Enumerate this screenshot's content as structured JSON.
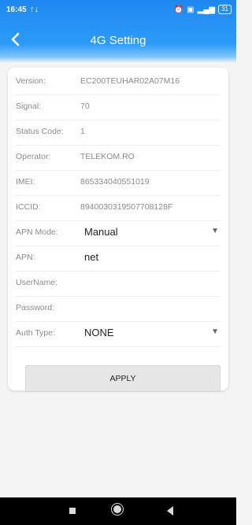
{
  "status_bar": {
    "time": "16:45",
    "network_icon": "network-arrows-icon",
    "icons": [
      "alarm-icon",
      "data-icon",
      "signal-icon"
    ],
    "battery": "31"
  },
  "header": {
    "title": "4G Setting",
    "back_icon": "chevron-left-icon",
    "accent": "#1e88f2"
  },
  "fields": {
    "version": {
      "label": "Version:",
      "value": "EC200TEUHAR02A07M16"
    },
    "signal": {
      "label": "Signal:",
      "value": "70"
    },
    "status_code": {
      "label": "Status Code:",
      "value": "1"
    },
    "operator": {
      "label": "Operator:",
      "value": "TELEKOM.RO"
    },
    "imei": {
      "label": "IMEI:",
      "value": "865334040551019"
    },
    "iccid": {
      "label": "ICCID:",
      "value": "8940030319507708128F"
    },
    "apn_mode": {
      "label": "APN Mode:",
      "value": "Manual"
    },
    "apn": {
      "label": "APN:",
      "value": "net"
    },
    "username": {
      "label": "UserName:",
      "value": ""
    },
    "password": {
      "label": "Password:",
      "value": ""
    },
    "auth_type": {
      "label": "Auth Type:",
      "value": "NONE"
    }
  },
  "apply_label": "APPLY",
  "nav": {
    "recent_icon": "square-icon",
    "home_icon": "circle-icon",
    "back_icon": "triangle-back-icon"
  }
}
